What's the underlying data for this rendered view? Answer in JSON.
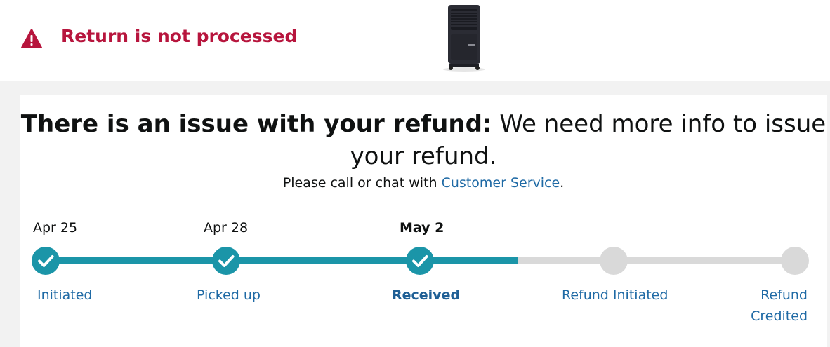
{
  "status": {
    "icon": "warning-triangle-icon",
    "title": "Return is not processed",
    "color": "#b7153d"
  },
  "product": {
    "image": "air-cooler-product-image"
  },
  "issue": {
    "headline_bold": "There is an issue with your refund:",
    "headline_rest": " We need more info to issue your refund.",
    "subline_prefix": "Please call or chat with ",
    "subline_link": "Customer Service",
    "subline_suffix": "."
  },
  "timeline": {
    "accent": "#1b95a8",
    "inactive": "#d9d9d9",
    "steps": [
      {
        "label": "Initiated",
        "date": "Apr 25",
        "completed": true,
        "current": false
      },
      {
        "label": "Picked up",
        "date": "Apr 28",
        "completed": true,
        "current": false
      },
      {
        "label": "Received",
        "date": "May 2",
        "completed": true,
        "current": true
      },
      {
        "label": "Refund Initiated",
        "date": "",
        "completed": false,
        "current": false
      },
      {
        "label": "Refund Credited",
        "date": "",
        "completed": false,
        "current": false
      }
    ]
  }
}
